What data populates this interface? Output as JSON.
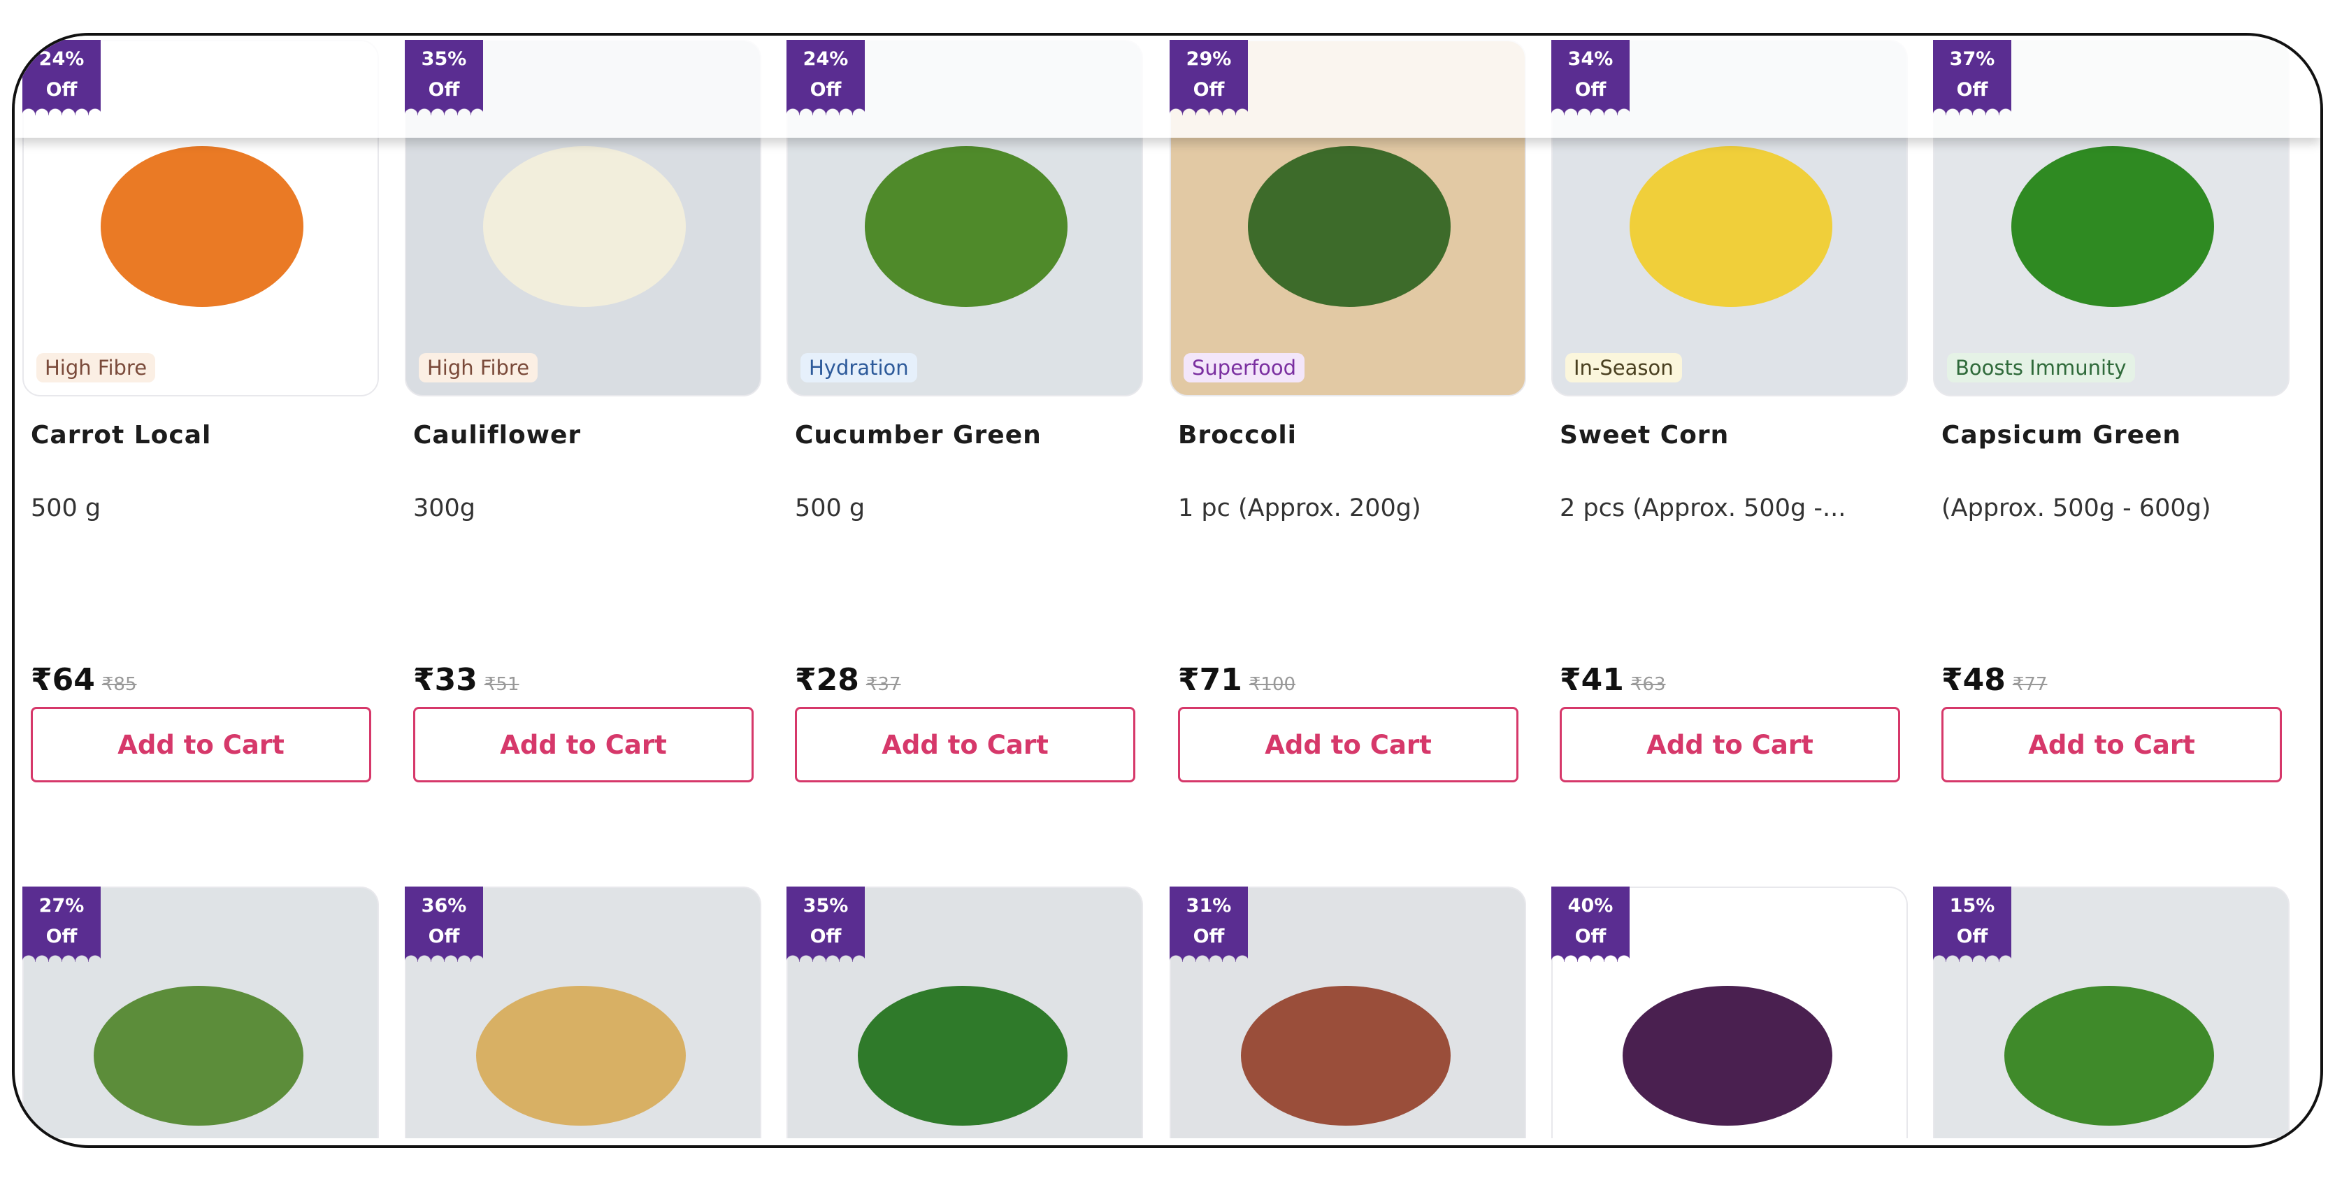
{
  "colors": {
    "badge": "#5a2d91",
    "accent": "#d6386a"
  },
  "add_to_cart_label": "Add to Cart",
  "products": [
    {
      "discount": "24%",
      "off": "Off",
      "tag": "High Fibre",
      "tag_bg": "#fbefe4",
      "tag_color": "#7a4a3a",
      "name": "Carrot Local",
      "weight": "500 g",
      "price": "₹64",
      "mrp": "₹85",
      "bg": "#ffffff",
      "veg": "#ea7a25"
    },
    {
      "discount": "35%",
      "off": "Off",
      "tag": "High Fibre",
      "tag_bg": "#fbefe4",
      "tag_color": "#7a4a3a",
      "name": "Cauliflower",
      "weight": "300g",
      "price": "₹33",
      "mrp": "₹51",
      "bg": "#d9dde2",
      "veg": "#f2eedc"
    },
    {
      "discount": "24%",
      "off": "Off",
      "tag": "Hydration",
      "tag_bg": "#e6f0fb",
      "tag_color": "#2d5a9a",
      "name": "Cucumber Green",
      "weight": "500 g",
      "price": "₹28",
      "mrp": "₹37",
      "bg": "#dde2e6",
      "veg": "#4f8a2a"
    },
    {
      "discount": "29%",
      "off": "Off",
      "tag": "Superfood",
      "tag_bg": "#f3e6fa",
      "tag_color": "#7a2fa0",
      "name": "Broccoli",
      "weight": "1 pc (Approx. 200g)",
      "price": "₹71",
      "mrp": "₹100",
      "bg": "#e2c9a4",
      "veg": "#3d6b2a"
    },
    {
      "discount": "34%",
      "off": "Off",
      "tag": "In-Season",
      "tag_bg": "#fbf6dc",
      "tag_color": "#4a4020",
      "name": "Sweet Corn",
      "weight": "2 pcs (Approx. 500g -...",
      "price": "₹41",
      "mrp": "₹63",
      "bg": "#dfe3e8",
      "veg": "#f0cf3a"
    },
    {
      "discount": "37%",
      "off": "Off",
      "tag": "Boosts Immunity",
      "tag_bg": "#e5f2e6",
      "tag_color": "#2f6a3a",
      "name": "Capsicum Green",
      "weight": "(Approx. 500g - 600g)",
      "price": "₹48",
      "mrp": "₹77",
      "bg": "#e3e6ea",
      "veg": "#2f8a22"
    }
  ],
  "products_row2": [
    {
      "discount": "27%",
      "off": "Off",
      "bg": "#dfe3e6",
      "veg": "#5c8d3a"
    },
    {
      "discount": "36%",
      "off": "Off",
      "bg": "#e0e3e6",
      "veg": "#d8b064"
    },
    {
      "discount": "35%",
      "off": "Off",
      "bg": "#dfe2e5",
      "veg": "#2f7a2a"
    },
    {
      "discount": "31%",
      "off": "Off",
      "bg": "#e0e2e5",
      "veg": "#9a4e3a"
    },
    {
      "discount": "40%",
      "off": "Off",
      "bg": "#ffffff",
      "veg": "#4a2050"
    },
    {
      "discount": "15%",
      "off": "Off",
      "bg": "#e2e5e8",
      "veg": "#3f8a2a"
    }
  ]
}
